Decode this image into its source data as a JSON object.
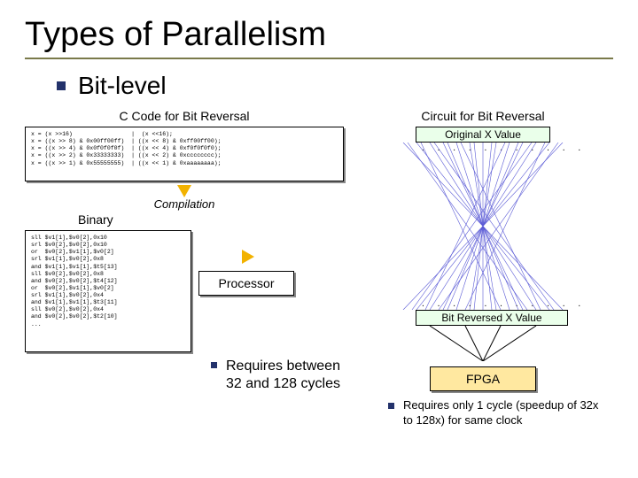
{
  "title": "Types of Parallelism",
  "subtitle": "Bit-level",
  "labels": {
    "ccode": "C Code for Bit Reversal",
    "circuit": "Circuit for Bit Reversal",
    "binary": "Binary",
    "compilation": "Compilation",
    "processor": "Processor",
    "fpga": "FPGA",
    "orig": "Original X Value",
    "rev": "Bit Reversed X Value"
  },
  "code1": "x = (x >>16)                 |  (x <<16);\nx = ((x >> 8) & 0x00ff00ff)  | ((x << 8) & 0xff00ff00);\nx = ((x >> 4) & 0x0f0f0f0f)  | ((x << 4) & 0xf0f0f0f0);\nx = ((x >> 2) & 0x33333333)  | ((x << 2) & 0xcccccccc);\nx = ((x >> 1) & 0x55555555)  | ((x << 1) & 0xaaaaaaaa);",
  "code2": "sll $v1[1],$v0[2],0x10\nsrl $v0[2],$v0[2],0x10\nor  $v0[2],$v1[1],$v0[2]\nsrl $v1[1],$v0[2],0x8\nand $v1[1],$v1[1],$t5[13]\nsll $v0[2],$v0[2],0x8\nand $v0[2],$v0[2],$t4[12]\nor  $v0[2],$v1[1],$v0[2]\nsrl $v1[1],$v0[2],0x4\nand $v1[1],$v1[1],$t3[11]\nsll $v0[2],$v0[2],0x4\nand $v0[2],$v0[2],$t2[10]\n...",
  "req1": "Requires between 32 and 128 cycles",
  "req2": "Requires only 1 cycle (speedup of 32x to 128x) for same clock"
}
